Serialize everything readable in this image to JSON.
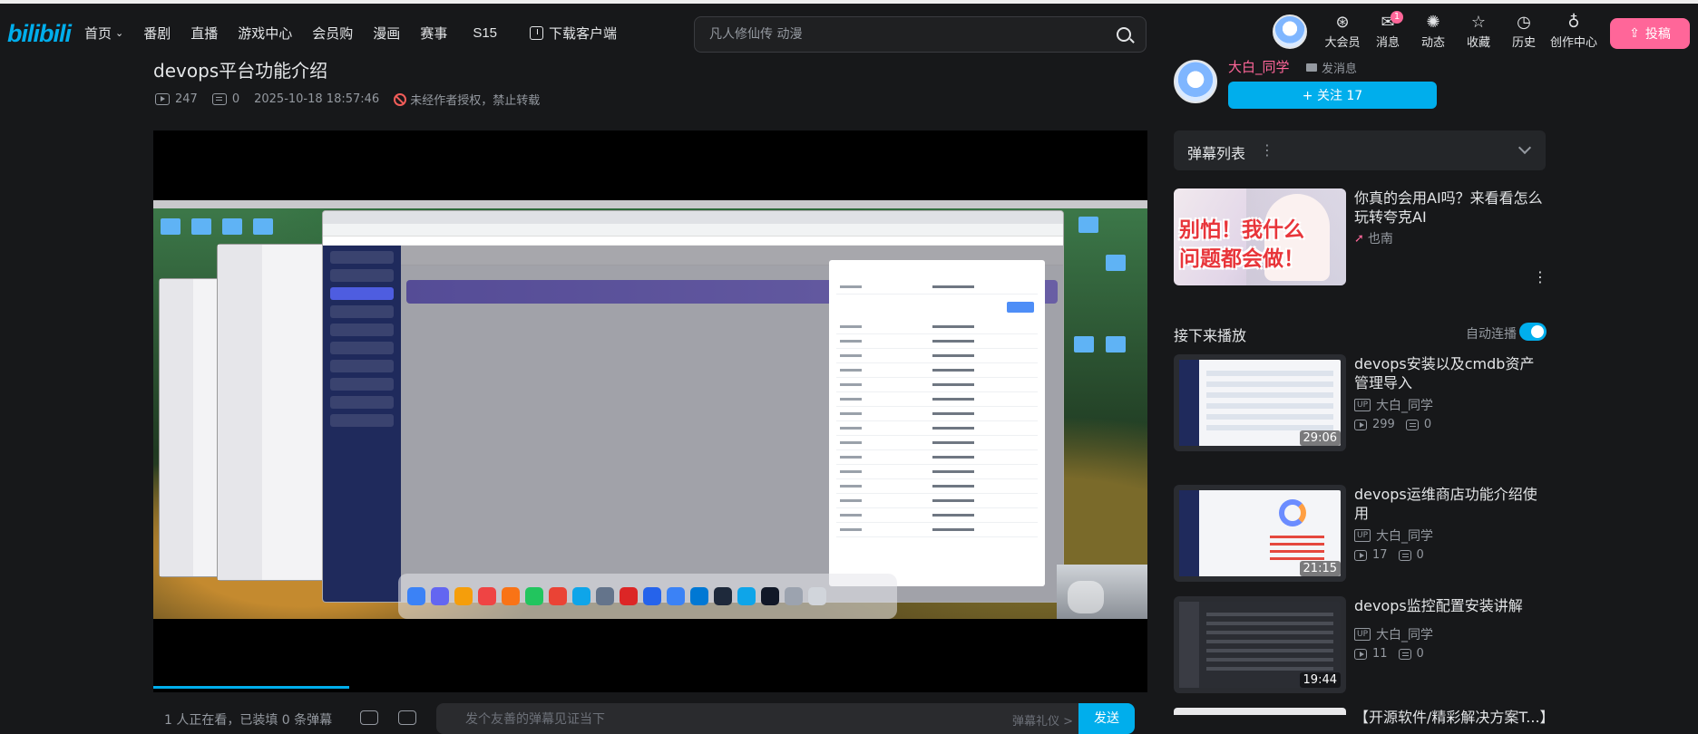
{
  "header": {
    "logo": "bilibili",
    "nav": [
      {
        "label": "首页",
        "has_dropdown": true
      },
      {
        "label": "番剧"
      },
      {
        "label": "直播"
      },
      {
        "label": "游戏中心"
      },
      {
        "label": "会员购"
      },
      {
        "label": "漫画"
      },
      {
        "label": "赛事"
      },
      {
        "label": "S15"
      },
      {
        "label": "下载客户端"
      }
    ],
    "search_placeholder": "凡人修仙传 动漫",
    "icons": [
      {
        "label": "大会员",
        "icon": "vip-icon"
      },
      {
        "label": "消息",
        "icon": "message-icon",
        "badge": "1"
      },
      {
        "label": "动态",
        "icon": "dynamic-icon"
      },
      {
        "label": "收藏",
        "icon": "star-icon"
      },
      {
        "label": "历史",
        "icon": "clock-icon"
      },
      {
        "label": "创作中心",
        "icon": "bulb-icon"
      }
    ],
    "upload_label": "投稿"
  },
  "video": {
    "title": "devops平台功能介绍",
    "views": "247",
    "danmaku_count": "0",
    "datetime": "2025-10-18 18:57:46",
    "copyright": "未经作者授权，禁止转载"
  },
  "player_bar": {
    "online": "1 人正在看，已装填 0 条弹幕",
    "danmaku_placeholder": "发个友善的弹幕见证当下",
    "etiquette": "弹幕礼仪 >",
    "send_label": "发送"
  },
  "uploader": {
    "name": "大白_同学",
    "message_label": "发消息",
    "follow_label": "+ 关注 17"
  },
  "danmaku_list": {
    "title": "弹幕列表"
  },
  "ad": {
    "thumb_text": "别怕！我什么问题都会做！",
    "title": "你真的会用AI吗？来看看怎么玩转夸克AI",
    "source": "也南"
  },
  "next": {
    "label": "接下来播放",
    "autoplay_label": "自动连播",
    "autoplay_on": true,
    "items": [
      {
        "title": "devops安装以及cmdb资产管理导入",
        "author": "大白_同学",
        "views": "299",
        "danmaku": "0",
        "duration": "29:06"
      },
      {
        "title": "devops运维商店功能介绍使用",
        "author": "大白_同学",
        "views": "17",
        "danmaku": "0",
        "duration": "21:15"
      },
      {
        "title": "devops监控配置安装讲解",
        "author": "大白_同学",
        "views": "11",
        "danmaku": "0",
        "duration": "19:44"
      }
    ],
    "partial_title": "【开源软件/精彩解决方案T...】"
  },
  "colors": {
    "accent": "#00aeec",
    "pink": "#ff6699",
    "background": "#17181a"
  }
}
